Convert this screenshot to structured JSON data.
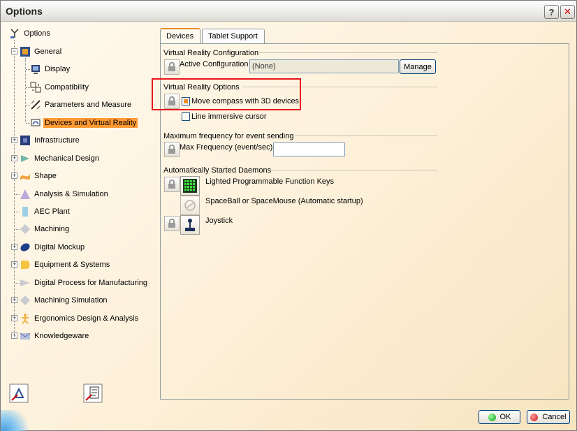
{
  "window": {
    "title": "Options"
  },
  "titlebar": {
    "help_glyph": "?",
    "close_glyph": "✕"
  },
  "tree": {
    "root": {
      "label": "Options",
      "icon": "options-icon"
    },
    "general": {
      "label": "General",
      "icon": "general-icon"
    },
    "general_children": [
      {
        "label": "Display",
        "icon": "display-icon"
      },
      {
        "label": "Compatibility",
        "icon": "compatibility-icon"
      },
      {
        "label": "Parameters and Measure",
        "icon": "parameters-icon"
      },
      {
        "label": "Devices and Virtual Reality",
        "icon": "devices-icon",
        "selected": true
      }
    ],
    "top_items": [
      {
        "label": "Infrastructure",
        "icon": "infrastructure-icon",
        "expandable": true
      },
      {
        "label": "Mechanical Design",
        "icon": "mechanical-design-icon",
        "expandable": true
      },
      {
        "label": "Shape",
        "icon": "shape-icon",
        "expandable": true
      },
      {
        "label": "Analysis & Simulation",
        "icon": "analysis-icon",
        "expandable": false
      },
      {
        "label": "AEC Plant",
        "icon": "aec-plant-icon",
        "expandable": false
      },
      {
        "label": "Machining",
        "icon": "machining-icon",
        "expandable": false
      },
      {
        "label": "Digital Mockup",
        "icon": "digital-mockup-icon",
        "expandable": true
      },
      {
        "label": "Equipment & Systems",
        "icon": "equipment-icon",
        "expandable": true
      },
      {
        "label": "Digital Process for Manufacturing",
        "icon": "digital-process-icon",
        "expandable": false
      },
      {
        "label": "Machining Simulation",
        "icon": "machining-simulation-icon",
        "expandable": true
      },
      {
        "label": "Ergonomics Design & Analysis",
        "icon": "ergonomics-icon",
        "expandable": true
      },
      {
        "label": "Knowledgeware",
        "icon": "knowledgeware-icon",
        "expandable": true
      }
    ]
  },
  "tabs": [
    {
      "label": "Devices",
      "active": true
    },
    {
      "label": "Tablet Support",
      "active": false
    }
  ],
  "vr_config": {
    "section": "Virtual Reality Configuration",
    "active_label": "Active Configuration",
    "active_value": "(None)",
    "manage_label": "Manage"
  },
  "vr_options": {
    "section": "Virtual Reality Options",
    "move_compass_label": "Move compass with 3D devices",
    "move_compass_checked": true,
    "line_cursor_label": "Line immersive cursor",
    "line_cursor_checked": false
  },
  "frequency": {
    "section": "Maximum frequency for event sending",
    "max_label": "Max Frequency (event/sec)",
    "max_value": ""
  },
  "daemons": {
    "section": "Automatically Started Daemons",
    "items": [
      {
        "label": "Lighted Programmable Function Keys",
        "icon": "function-keys-icon"
      },
      {
        "label": "SpaceBall or SpaceMouse (Automatic startup)",
        "icon": "spaceball-icon"
      },
      {
        "label": "Joystick",
        "icon": "joystick-icon"
      }
    ]
  },
  "footer": {
    "ok_label": "OK",
    "cancel_label": "Cancel"
  },
  "colors": {
    "selection": "#ff9933",
    "highlight_box": "#e8141b",
    "tab_accent": "#e68b2c"
  }
}
